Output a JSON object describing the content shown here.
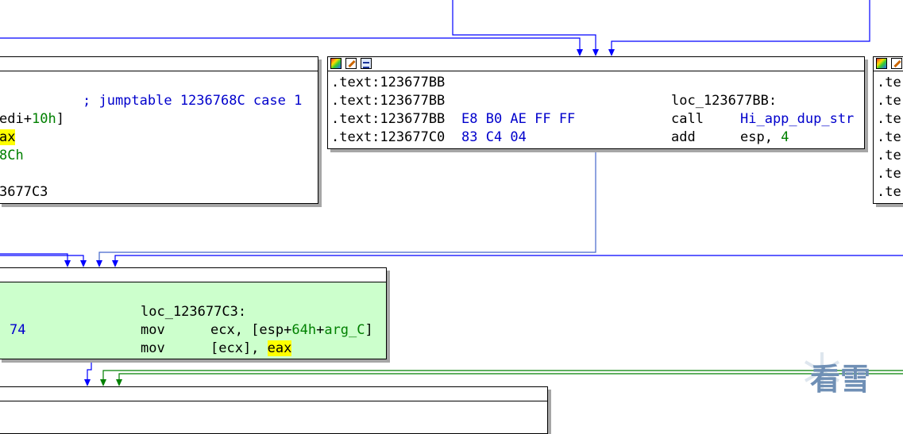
{
  "colors": {
    "blue_edge": "#0000ff",
    "green_edge": "#008000",
    "edge_mid": "#4466cc",
    "highlight": "#ffff00",
    "node_green": "#ccffcc"
  },
  "icons": [
    "color-palette-icon",
    "edit-pencil-icon",
    "graph-view-icon"
  ],
  "left_node": {
    "lines": [
      {
        "tokens": [
          {
            "t": "; jumptable 1236768C case 1",
            "c": "blu"
          }
        ]
      },
      {
        "tokens": [
          {
            "t": "edi",
            "c": "blk"
          },
          {
            "t": "+",
            "c": "blk"
          },
          {
            "t": "10h",
            "c": "grn"
          },
          {
            "t": "]",
            "c": "blk"
          }
        ]
      },
      {
        "tokens": [
          {
            "t": "ax",
            "c": "blk",
            "hl": true
          }
        ]
      },
      {
        "tokens": [
          {
            "t": "8Ch",
            "c": "grn"
          }
        ]
      },
      {
        "tokens": [
          {
            "t": "",
            "c": "blk"
          }
        ]
      },
      {
        "tokens": [
          {
            "t": "3677C3",
            "c": "blk"
          }
        ]
      }
    ]
  },
  "center_node": {
    "lines": [
      {
        "addr": ".text:123677BB",
        "bytes": "",
        "mnem": "",
        "ops": []
      },
      {
        "addr": ".text:123677BB",
        "bytes": "",
        "mnem": "loc_123677BB:",
        "ops": []
      },
      {
        "addr": ".text:123677BB",
        "bytes": "E8 B0 AE FF FF",
        "mnem": "call",
        "ops": [
          {
            "t": "Hi_app_dup_str",
            "c": "blu"
          }
        ]
      },
      {
        "addr": ".text:123677C0",
        "bytes": "83 C4 04",
        "mnem": "add",
        "ops": [
          {
            "t": "esp, ",
            "c": "blk"
          },
          {
            "t": "4",
            "c": "grn"
          }
        ]
      }
    ]
  },
  "right_node": {
    "lines": [
      ".te",
      ".te",
      ".te",
      ".te",
      ".te",
      ".te",
      ".te"
    ]
  },
  "green_node": {
    "lines": [
      {
        "bytes": "",
        "mnem": "",
        "ops": []
      },
      {
        "bytes": "",
        "mnem": "loc_123677C3:",
        "ops": []
      },
      {
        "bytes": "74",
        "mnem": "mov",
        "ops": [
          {
            "t": "ecx, [esp+",
            "c": "blk"
          },
          {
            "t": "64h",
            "c": "grn"
          },
          {
            "t": "+",
            "c": "blk"
          },
          {
            "t": "arg_C",
            "c": "grn"
          },
          {
            "t": "]",
            "c": "blk"
          }
        ]
      },
      {
        "bytes": "",
        "mnem": "mov",
        "ops": [
          {
            "t": "[ecx], ",
            "c": "blk"
          },
          {
            "t": "eax",
            "c": "blk",
            "hl": true
          }
        ]
      }
    ]
  },
  "watermark": {
    "text": "看雪"
  }
}
